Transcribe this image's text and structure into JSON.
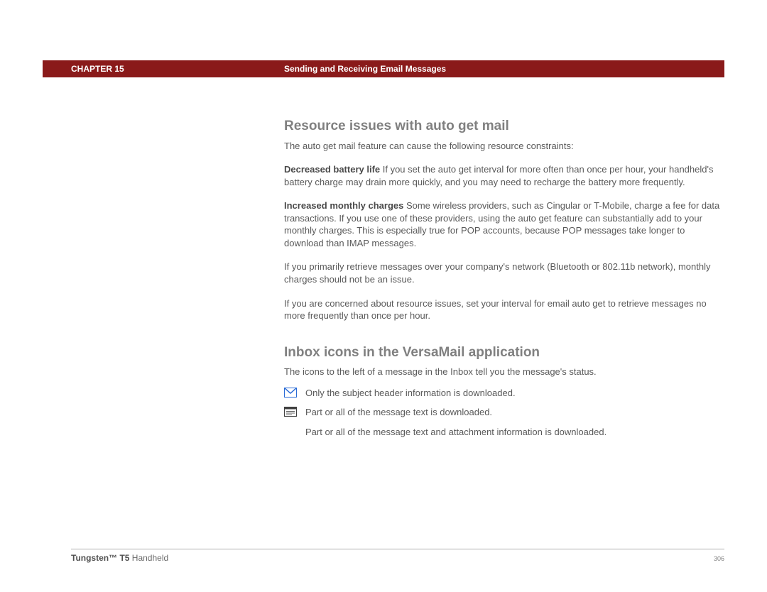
{
  "header": {
    "chapter_label": "CHAPTER 15",
    "title": "Sending and Receiving Email Messages"
  },
  "section1": {
    "heading": "Resource issues with auto get mail",
    "intro": "The auto get mail feature can cause the following resource constraints:",
    "p1_lead": "Decreased battery life",
    "p1_body": "   If you set the auto get interval for more often than once per hour, your handheld's battery charge may drain more quickly, and you may need to recharge the battery more frequently.",
    "p2_lead": "Increased monthly charges",
    "p2_body": "   Some wireless providers, such as Cingular or T-Mobile, charge a fee for data transactions. If you use one of these providers, using the auto get feature can substantially add to your monthly charges. This is especially true for POP accounts, because POP messages take longer to download than IMAP messages.",
    "p3": "If you primarily retrieve messages over your company's network (Bluetooth or 802.11b network), monthly charges should not be an issue.",
    "p4": "If you are concerned about resource issues, set your interval for email auto get to retrieve messages no more frequently than once per hour."
  },
  "section2": {
    "heading": "Inbox icons in the VersaMail application",
    "intro": "The icons to the left of a message in the Inbox tell you the message's status.",
    "rows": [
      {
        "text": "Only the subject header information is downloaded."
      },
      {
        "text": "Part or all of the message text is downloaded."
      },
      {
        "text": "Part or all of the message text and attachment information is downloaded."
      }
    ]
  },
  "footer": {
    "product_strong": "Tungsten™ T5",
    "product_rest": " Handheld",
    "page_number": "306"
  }
}
